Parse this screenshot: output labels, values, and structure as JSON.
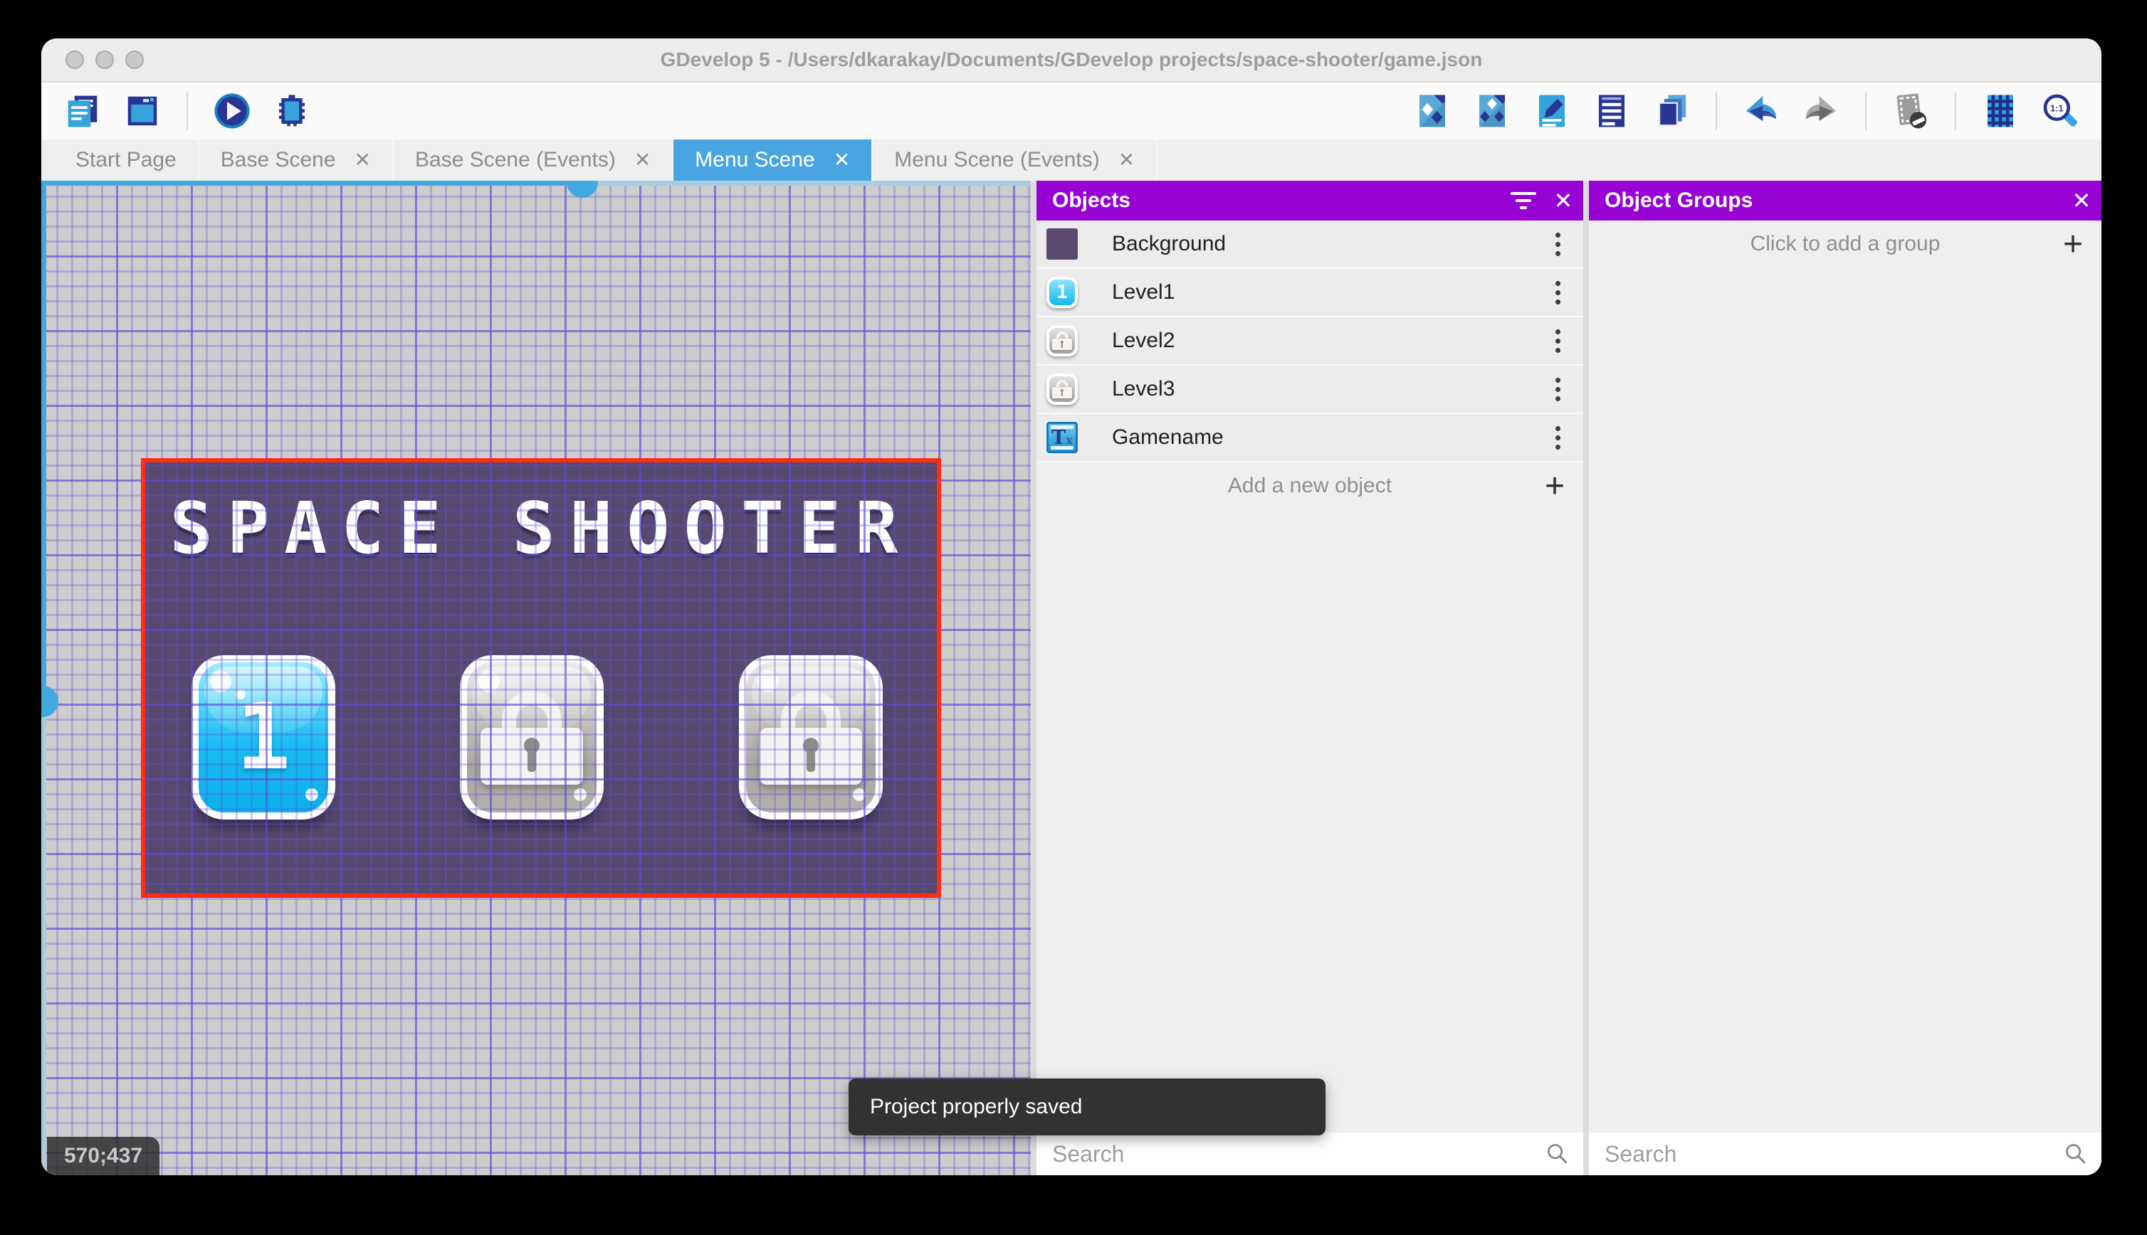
{
  "window": {
    "title": "GDevelop 5 - /Users/dkarakay/Documents/GDevelop projects/space-shooter/game.json"
  },
  "toolbar": {
    "left_icons": [
      "project-manager",
      "scene-properties",
      "play",
      "debug"
    ],
    "right_icons": [
      "objects-editor",
      "object-groups-editor",
      "properties",
      "instances-list",
      "layers",
      "undo",
      "redo",
      "toggle-window-mask",
      "grid",
      "zoom-original"
    ]
  },
  "tabs": [
    {
      "label": "Start Page",
      "active": false,
      "closable": false
    },
    {
      "label": "Base Scene",
      "active": false,
      "closable": true
    },
    {
      "label": "Base Scene (Events)",
      "active": false,
      "closable": true
    },
    {
      "label": "Menu Scene",
      "active": true,
      "closable": true
    },
    {
      "label": "Menu Scene (Events)",
      "active": false,
      "closable": true
    }
  ],
  "canvas": {
    "scene_title": "SPACE SHOOTER",
    "cursor_coordinates": "570;437",
    "level_buttons": [
      {
        "name": "Level1",
        "label": "1",
        "locked": false
      },
      {
        "name": "Level2",
        "label": "",
        "locked": true
      },
      {
        "name": "Level3",
        "label": "",
        "locked": true
      }
    ]
  },
  "objects_panel": {
    "title": "Objects",
    "items": [
      {
        "name": "Background",
        "thumb": "purple-swatch"
      },
      {
        "name": "Level1",
        "thumb": "blue-button-1"
      },
      {
        "name": "Level2",
        "thumb": "gray-lock-button"
      },
      {
        "name": "Level3",
        "thumb": "gray-lock-button"
      },
      {
        "name": "Gamename",
        "thumb": "text-object"
      }
    ],
    "add_label": "Add a new object",
    "search_placeholder": "Search"
  },
  "groups_panel": {
    "title": "Object Groups",
    "empty_label": "Click to add a group",
    "search_placeholder": "Search"
  },
  "toast": {
    "message": "Project properly saved"
  },
  "colors": {
    "panel_header_purple": "#9803d3",
    "active_tab_blue": "#49a5e2",
    "selection_border_red": "#ff2d12",
    "scene_background": "#57496e",
    "grid_line": "#584ad6",
    "toolbar_icon_blue": "#35a3dc",
    "toolbar_icon_navy": "#283593"
  }
}
